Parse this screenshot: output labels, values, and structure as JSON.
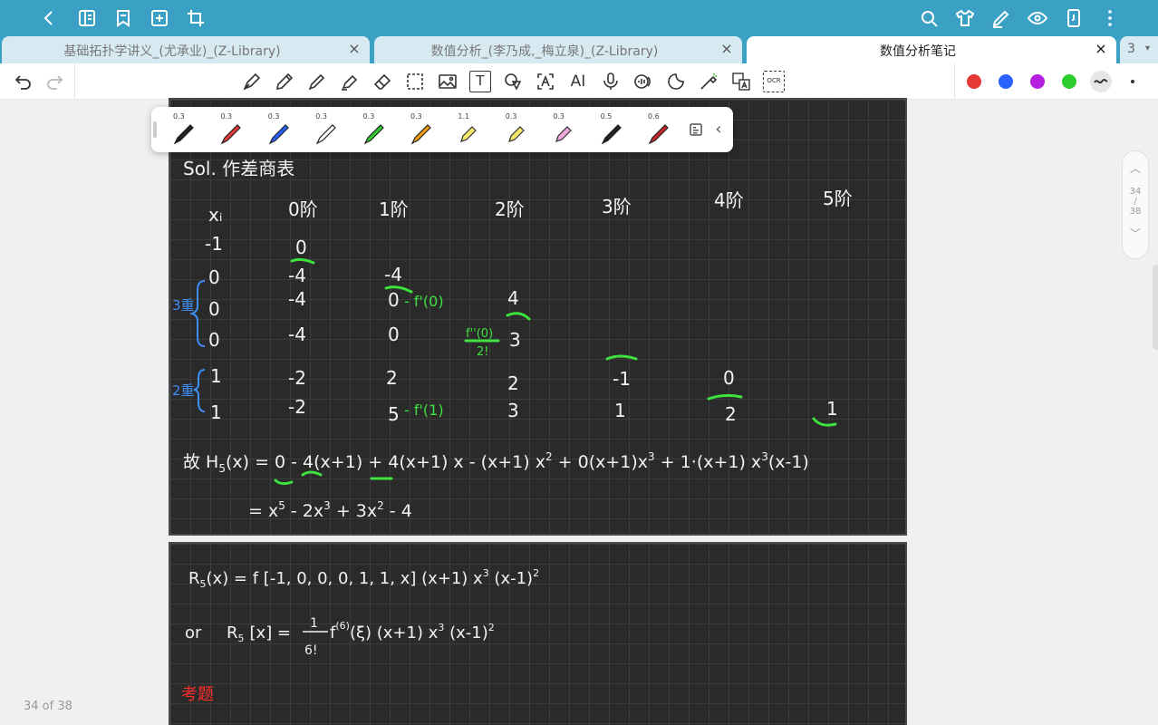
{
  "tabs": [
    {
      "label": "基础拓扑学讲义_(尤承业)_(Z-Library)",
      "close": "×"
    },
    {
      "label": "数值分析_(李乃成,_梅立泉)_(Z-Library)",
      "close": "×"
    },
    {
      "label": "数值分析笔记",
      "close": "×"
    }
  ],
  "tab_count": "3",
  "toolbar": {
    "text_tool": "T",
    "ai_tool": "AI",
    "ocr_tool": "OCR"
  },
  "pen_sizes": [
    "0.3",
    "0.3",
    "0.3",
    "0.3",
    "0.3",
    "0.3",
    "1.1",
    "0.3",
    "0.3",
    "0.5",
    "0.6"
  ],
  "colors": {
    "red": "#e53935",
    "blue": "#2962ff",
    "purple": "#b620e0",
    "green": "#2ecc2e",
    "accent": "#3aa0c4",
    "ink_white": "#f2f2f2",
    "ink_green": "#3ee23e",
    "ink_blue": "#3d8ef5",
    "ink_red": "#ff2a2a"
  },
  "note": {
    "sol": "Sol. 作差商表",
    "headers": [
      "xᵢ",
      "0阶",
      "1阶",
      "2阶",
      "3阶",
      "4阶",
      "5阶"
    ],
    "rows": [
      [
        "-1",
        "0"
      ],
      [
        "0",
        "-4",
        "-4"
      ],
      [
        "0",
        "-4",
        "0",
        "4"
      ],
      [
        "0",
        "-4",
        "0",
        "3"
      ],
      [
        "1",
        "-2",
        "2",
        "2",
        "-1",
        "0"
      ],
      [
        "1",
        "-2",
        "5",
        "3",
        "1",
        "2",
        "1"
      ]
    ],
    "triple": "3重",
    "double": "2重",
    "fprime0": "- f'(0)",
    "fprime1": "- f'(1)",
    "fsecond_num": "f''(0)",
    "fsecond_den": "2!",
    "eq_lead": "故 H",
    "eq_sub": "5",
    "eq_mid": "(x) = 0 - 4(x+1) + 4(x+1) x - (x+1) x",
    "eq_sup2": "2",
    "eq_mid2": " + 0(x+1)x",
    "eq_sup3": "3",
    "eq_mid3": " + 1·(x+1) x",
    "eq_sup3b": "3",
    "eq_tail": "(x-1)",
    "eq2_a": "= x",
    "eq2_a_sup": "5",
    "eq2_b": " - 2x",
    "eq2_b_sup": "3",
    "eq2_c": " + 3x",
    "eq2_c_sup": "2",
    "eq2_d": " - 4",
    "r_lead": "R",
    "r_sub": "5",
    "r_line": "(x) = f [-1, 0, 0, 0, 1, 1, x] (x+1) x",
    "r_sup3": "3",
    "r_tail": " (x-1)",
    "r_sup2": "2",
    "or_word": "or",
    "r2_lead": "R",
    "r2_sub": "5",
    "r2_bracket": "[x] =",
    "r2_num": "1",
    "r2_den": "6!",
    "r2_f": "f",
    "r2_sup6": "(6)",
    "r2_tail": "(ξ) (x+1) x",
    "r2_sup3": "3",
    "r2_tail2": " (x-1)",
    "r2_sup2": "2",
    "exam": "考题"
  },
  "pager": {
    "current": "34",
    "sep": "/",
    "total": "38"
  },
  "page_counter": "34 of 38"
}
